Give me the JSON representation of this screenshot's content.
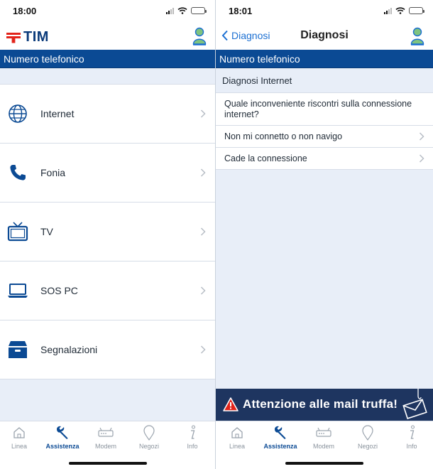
{
  "left": {
    "status": {
      "time": "18:00"
    },
    "header": {
      "logo_text": "TIM"
    },
    "band": "Numero telefonico",
    "menu": [
      {
        "label": "Internet",
        "icon": "globe-icon"
      },
      {
        "label": "Fonia",
        "icon": "phone-icon"
      },
      {
        "label": "TV",
        "icon": "tv-icon"
      },
      {
        "label": "SOS PC",
        "icon": "laptop-icon"
      },
      {
        "label": "Segnalazioni",
        "icon": "archive-box-icon"
      }
    ],
    "tabs": [
      {
        "label": "Linea",
        "icon": "house-icon",
        "active": false
      },
      {
        "label": "Assistenza",
        "icon": "wrench-icon",
        "active": true
      },
      {
        "label": "Modem",
        "icon": "modem-icon",
        "active": false
      },
      {
        "label": "Negozi",
        "icon": "map-pin-icon",
        "active": false
      },
      {
        "label": "Info",
        "icon": "info-icon",
        "active": false
      }
    ]
  },
  "right": {
    "status": {
      "time": "18:01"
    },
    "header": {
      "back_label": "Diagnosi",
      "title": "Diagnosi"
    },
    "band": "Numero telefonico",
    "section_title": "Diagnosi Internet",
    "question": "Quale inconveniente riscontri sulla connessione internet?",
    "options": [
      {
        "label": "Non mi connetto o non navigo"
      },
      {
        "label": "Cade la connessione"
      }
    ],
    "banner": {
      "text": "Attenzione alle mail truffa!"
    },
    "tabs": [
      {
        "label": "Linea",
        "icon": "house-icon",
        "active": false
      },
      {
        "label": "Assistenza",
        "icon": "wrench-icon",
        "active": true
      },
      {
        "label": "Modem",
        "icon": "modem-icon",
        "active": false
      },
      {
        "label": "Negozi",
        "icon": "map-pin-icon",
        "active": false
      },
      {
        "label": "Info",
        "icon": "info-icon",
        "active": false
      }
    ]
  },
  "colors": {
    "brand_blue": "#0b4a94",
    "brand_red": "#e2231a",
    "banner_bg": "#1e3560",
    "link_blue": "#1b6fd2"
  }
}
